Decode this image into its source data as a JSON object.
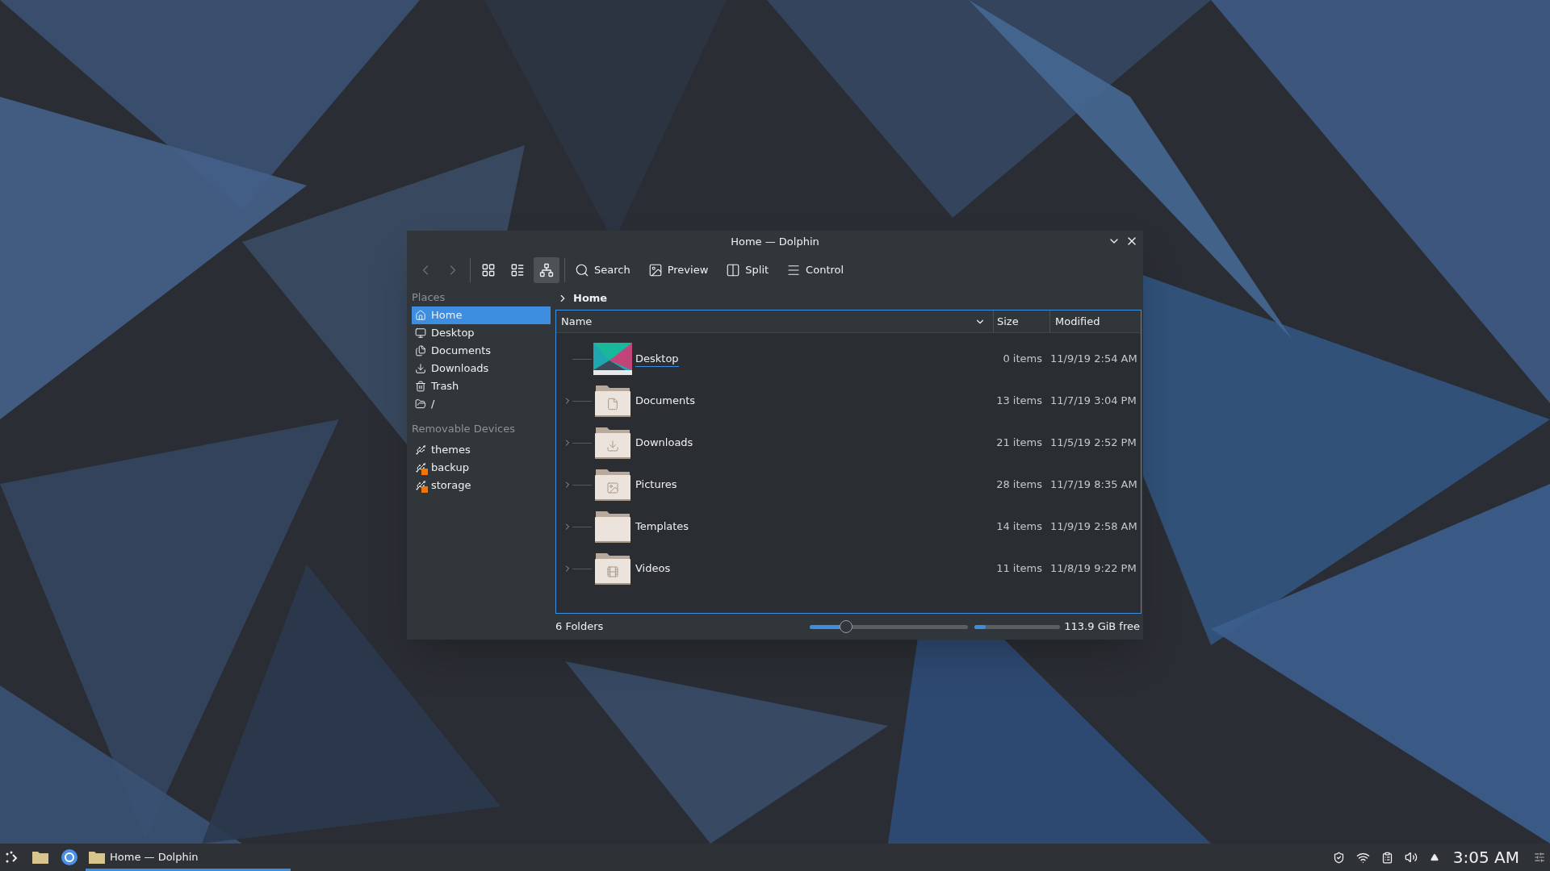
{
  "window": {
    "title": "Home — Dolphin"
  },
  "toolbar": {
    "navigation": [
      {
        "disabled": true
      },
      {
        "disabled": true
      }
    ],
    "view_modes": [
      {
        "selected": false
      },
      {
        "selected": false
      },
      {
        "selected": true
      }
    ],
    "actions": [
      "Search",
      "Preview",
      "Split",
      "Control"
    ]
  },
  "places": {
    "heading": "Places",
    "items": [
      {
        "label": "Home",
        "selected": true
      },
      {
        "label": "Desktop",
        "selected": false
      },
      {
        "label": "Documents",
        "selected": false
      },
      {
        "label": "Downloads",
        "selected": false
      },
      {
        "label": "Trash",
        "selected": false
      },
      {
        "label": "/",
        "selected": false
      }
    ]
  },
  "removable_devices": {
    "heading": "Removable Devices",
    "items": [
      {
        "label": "themes",
        "mounted": true
      },
      {
        "label": "backup",
        "mounted": false
      },
      {
        "label": "storage",
        "mounted": false
      }
    ]
  },
  "breadcrumb": [
    "Home"
  ],
  "table": {
    "columns": [
      "Name",
      "Size",
      "Modified"
    ],
    "rows": [
      {
        "name": "Desktop",
        "size": "0 items",
        "modified": "11/9/19 2:54 AM",
        "kind": "thumbnail",
        "expandable": false,
        "hovered": true
      },
      {
        "name": "Documents",
        "size": "13 items",
        "modified": "11/7/19 3:04 PM",
        "kind": "folder",
        "expandable": true,
        "hovered": false
      },
      {
        "name": "Downloads",
        "size": "21 items",
        "modified": "11/5/19 2:52 PM",
        "kind": "folder",
        "expandable": true,
        "hovered": false
      },
      {
        "name": "Pictures",
        "size": "28 items",
        "modified": "11/7/19 8:35 AM",
        "kind": "folder",
        "expandable": true,
        "hovered": false
      },
      {
        "name": "Templates",
        "size": "14 items",
        "modified": "11/9/19 2:58 AM",
        "kind": "folder",
        "expandable": true,
        "hovered": false
      },
      {
        "name": "Videos",
        "size": "11 items",
        "modified": "11/8/19 9:22 PM",
        "kind": "folder",
        "expandable": true,
        "hovered": false
      }
    ]
  },
  "status_bar": {
    "text": "6 Folders",
    "zoom": {
      "level": 0.21
    },
    "disk": {
      "level": 0.13
    },
    "free_space": "113.9 GiB free"
  },
  "taskbar": {
    "tasks": [
      {
        "label": "Home — Dolphin",
        "active": true
      }
    ],
    "clock": "3:05 AM"
  }
}
